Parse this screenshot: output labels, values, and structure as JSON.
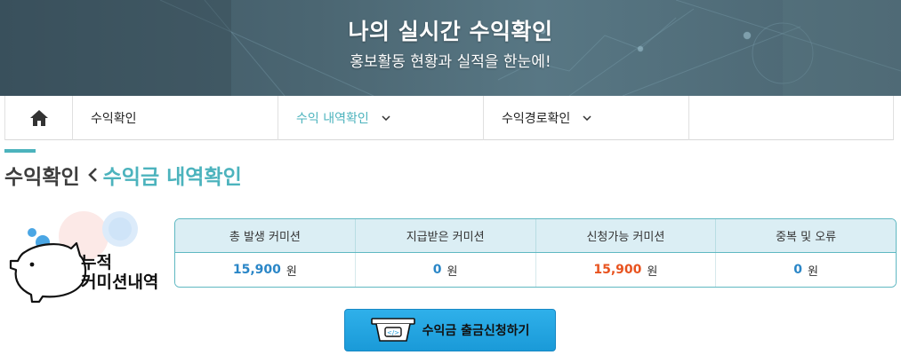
{
  "banner": {
    "title": "나의 실시간 수익확인",
    "subtitle": "홍보활동 현황과 실적을 한눈에!"
  },
  "nav": {
    "home_icon": "home-icon",
    "items": [
      {
        "label": "수익확인",
        "dropdown": false
      },
      {
        "label": "수익 내역확인",
        "dropdown": true,
        "active": true
      },
      {
        "label": "수익경로확인",
        "dropdown": true
      }
    ]
  },
  "breadcrumb": {
    "root": "수익확인",
    "separator_icon": "chevron-left-icon",
    "current": "수익금 내역확인"
  },
  "summary": {
    "label_line1": "누적",
    "label_line2": "커미션내역",
    "icon": "piggy-bank-icon",
    "columns": [
      {
        "header": "총 발생 커미션",
        "value": "15,900",
        "unit": "원"
      },
      {
        "header": "지급받은 커미션",
        "value": "0",
        "unit": "원"
      },
      {
        "header": "신청가능 커미션",
        "value": "15,900",
        "unit": "원"
      },
      {
        "header": "중복 및 오류",
        "value": "0",
        "unit": "원"
      }
    ]
  },
  "withdraw": {
    "label": "수익금 출금신청하기",
    "icon": "cash-withdraw-icon"
  },
  "colors": {
    "accent": "#4cb3bd",
    "value_blue": "#2a86c7",
    "value_red": "#e8531f",
    "button": "#1ea3e0"
  }
}
